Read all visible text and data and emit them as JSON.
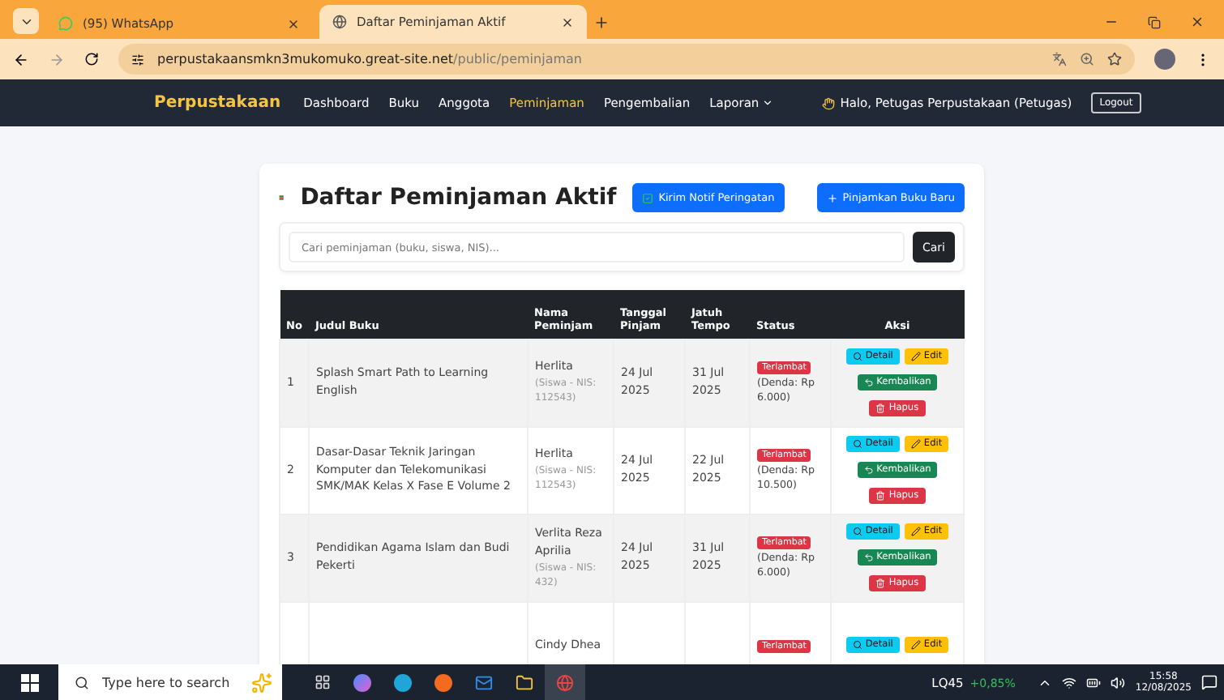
{
  "browser": {
    "tabs": [
      {
        "title": "(95) WhatsApp",
        "selected": false,
        "kind": "chat"
      },
      {
        "title": "Daftar Peminjaman Aktif",
        "selected": true,
        "kind": "globe"
      }
    ],
    "address": {
      "host": "perpustakaansmkn3mukomuko.great-site.net",
      "path": "/public/peminjaman"
    }
  },
  "navbar": {
    "brand": "Perpustakaan",
    "items": [
      {
        "label": "Dashboard",
        "selected": false,
        "kind": "link"
      },
      {
        "label": "Buku",
        "selected": false,
        "kind": "link"
      },
      {
        "label": "Anggota",
        "selected": false,
        "kind": "link"
      },
      {
        "label": "Peminjaman",
        "selected": true,
        "kind": "link"
      },
      {
        "label": "Pengembalian",
        "selected": false,
        "kind": "link"
      },
      {
        "label": "Laporan",
        "selected": false,
        "kind": "dropdown"
      }
    ],
    "greeting": "Halo, Petugas Perpustakaan (Petugas)",
    "logout": "Logout"
  },
  "page": {
    "title": "Daftar Peminjaman Aktif",
    "notify_button": "Kirim Notif Peringatan",
    "new_button": "Pinjamkan Buku Baru",
    "search": {
      "placeholder": "Cari peminjaman (buku, siswa, NIS)...",
      "button": "Cari"
    },
    "table": {
      "columns": [
        "No",
        "Judul Buku",
        "Nama Peminjam",
        "Tanggal Pinjam",
        "Jatuh Tempo",
        "Status",
        "Aksi"
      ],
      "rows": [
        {
          "no": "1",
          "title": "Splash Smart Path to Learning English",
          "name": "Herlita",
          "info": "(Siswa - NIS: 112543)",
          "loan": "24 Jul 2025",
          "due": "31 Jul 2025",
          "status": "Terlambat",
          "fine": "(Denda: Rp 6.000)",
          "actions": [
            {
              "label": "Detail",
              "kind": "detail"
            },
            {
              "label": "Edit",
              "kind": "edit"
            },
            {
              "label": "Kembalikan",
              "kind": "return"
            },
            {
              "label": "Hapus",
              "kind": "delete"
            }
          ]
        },
        {
          "no": "2",
          "title": "Dasar-Dasar Teknik Jaringan Komputer dan Telekomunikasi SMK/MAK Kelas X Fase E Volume 2",
          "name": "Herlita",
          "info": "(Siswa - NIS: 112543)",
          "loan": "24 Jul 2025",
          "due": "22 Jul 2025",
          "status": "Terlambat",
          "fine": "(Denda: Rp 10.500)",
          "actions": [
            {
              "label": "Detail",
              "kind": "detail"
            },
            {
              "label": "Edit",
              "kind": "edit"
            },
            {
              "label": "Kembalikan",
              "kind": "return"
            },
            {
              "label": "Hapus",
              "kind": "delete"
            }
          ]
        },
        {
          "no": "3",
          "title": "Pendidikan Agama Islam dan Budi Pekerti",
          "name": "Verlita Reza Aprilia",
          "info": "(Siswa - NIS: 432)",
          "loan": "24 Jul 2025",
          "due": "31 Jul 2025",
          "status": "Terlambat",
          "fine": "(Denda: Rp 6.000)",
          "actions": [
            {
              "label": "Detail",
              "kind": "detail"
            },
            {
              "label": "Edit",
              "kind": "edit"
            },
            {
              "label": "Kembalikan",
              "kind": "return"
            },
            {
              "label": "Hapus",
              "kind": "delete"
            }
          ]
        },
        {
          "no": "",
          "title": "",
          "name": "Cindy Dhea",
          "info": "",
          "loan": "",
          "due": "",
          "status": "Terlambat",
          "fine": "",
          "actions": [
            {
              "label": "Detail",
              "kind": "detail"
            },
            {
              "label": "Edit",
              "kind": "edit"
            }
          ]
        }
      ]
    }
  },
  "taskbar": {
    "search_placeholder": "Type here to search",
    "stock": {
      "name": "LQ45",
      "change": "+0,85%"
    },
    "time": "15:58",
    "date": "12/08/2025"
  }
}
